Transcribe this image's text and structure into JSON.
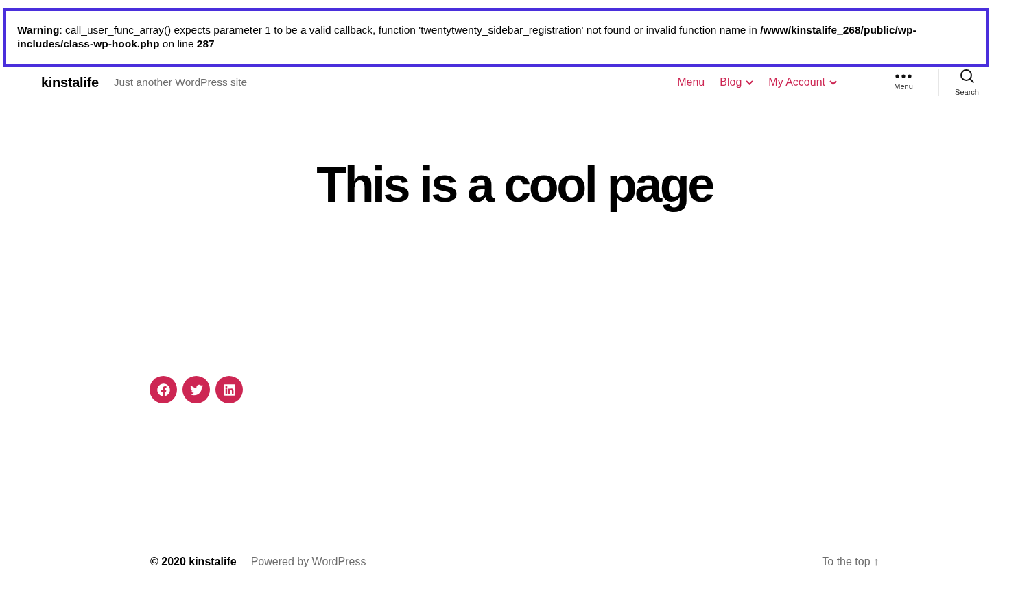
{
  "warning": {
    "text": "**Warning**: call_user_func_array() expects parameter 1 to be a valid callback, function 'twentytwenty_sidebar_registration' not found or invalid function name in **/www/kinstalife_268/public/wp-includes/class-wp-hook.php** on line **287**"
  },
  "header": {
    "site_title": "kinstalife",
    "tagline": "Just another WordPress site",
    "nav": [
      {
        "label": "Menu",
        "selected": false,
        "has_submenu": false
      },
      {
        "label": "Blog",
        "selected": false,
        "has_submenu": true
      },
      {
        "label": "My Account",
        "selected": true,
        "has_submenu": true
      }
    ],
    "toggles": [
      {
        "kind": "menu",
        "label": "Menu"
      },
      {
        "kind": "search",
        "label": "Search"
      }
    ]
  },
  "page_title": "This is a cool page",
  "social_links": [
    {
      "kind": "facebook"
    },
    {
      "kind": "twitter"
    },
    {
      "kind": "linkedin"
    }
  ],
  "footer": {
    "copyright": "© 2020 kinstalife",
    "powered_by": "Powered by WordPress",
    "to_top": "To the top ↑"
  }
}
